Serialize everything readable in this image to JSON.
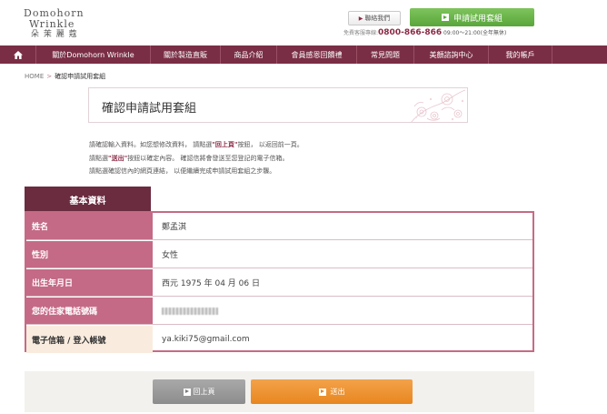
{
  "header": {
    "logo_en_line1": "Domohorn",
    "logo_en_line2": "Wrinkle",
    "logo_zh": "朵 茉 麗 蔻",
    "contact_button": "聯絡我們",
    "apply_button": "申請試用套組",
    "hotline_label": "免費客服專線:",
    "hotline_number": "0800-866-866",
    "hotline_hours": "09:00～21:00(全年無休)"
  },
  "nav": {
    "items": [
      {
        "label": "關於Domohorn Wrinkle"
      },
      {
        "label": "關於製造直販"
      },
      {
        "label": "商品介紹"
      },
      {
        "label": "會員感恩回饋禮"
      },
      {
        "label": "常見問題"
      },
      {
        "label": "美顏諮詢中心"
      },
      {
        "label": "我的帳戶"
      }
    ]
  },
  "breadcrumb": {
    "home": "HOME",
    "sep": ">",
    "current": "確認申請試用套組"
  },
  "page_title": "確認申請試用套組",
  "instructions": {
    "l1a": "請確認輸入資料。如您想修改資料， 請點選",
    "l1b": "\"回上頁\"",
    "l1c": "按鈕， 以返回前一頁。",
    "l2a": "請點選",
    "l2b": "\"送出\"",
    "l2c": "按鈕以確定內容。 確認信將會發送至您登記的電子信箱。",
    "l3": "請點選確認信內的網頁連結， 以便繼續完成申請試用套組之步驟。"
  },
  "form": {
    "section_tab": "基本資料",
    "rows": [
      {
        "label": "姓名",
        "value": "鄭孟淇"
      },
      {
        "label": "性別",
        "value": "女性"
      },
      {
        "label": "出生年月日",
        "value": "西元 1975 年 04 月 06 日"
      },
      {
        "label": "您的住家電話號碼",
        "value": ""
      },
      {
        "label": "電子信箱 / 登入帳號",
        "value": "ya.kiki75@gmail.com"
      }
    ]
  },
  "buttons": {
    "back": "回上頁",
    "submit": "送出"
  },
  "colors": {
    "brand": "#7a2e45",
    "label_bg": "#c46a86",
    "apply_green": "#5aa63c",
    "submit_orange": "#e8861f"
  }
}
